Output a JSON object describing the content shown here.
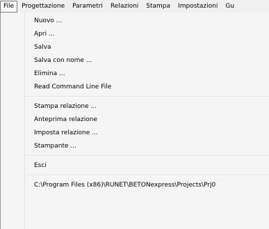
{
  "menubar": {
    "items": [
      {
        "label": "File",
        "active": true
      },
      {
        "label": "Progettazione"
      },
      {
        "label": "Parametri"
      },
      {
        "label": "Relazioni"
      },
      {
        "label": "Stampa"
      },
      {
        "label": "Impostazioni"
      },
      {
        "label": "Gu"
      }
    ]
  },
  "file_menu": {
    "group1": [
      {
        "label": "Nuovo ..."
      },
      {
        "label": "Apri ..."
      },
      {
        "label": "Salva"
      },
      {
        "label": "Salva con nome ..."
      },
      {
        "label": "Elimina ..."
      },
      {
        "label": "Read Command Line File"
      }
    ],
    "group2": [
      {
        "label": "Stampa relazione ..."
      },
      {
        "label": "Anteprima relazione"
      },
      {
        "label": "Imposta relazione ..."
      },
      {
        "label": "Stampante ..."
      }
    ],
    "group3": [
      {
        "label": "Esci"
      }
    ],
    "group4": [
      {
        "label": "C:\\Program Files (x86)\\RUNET\\BETONexpress\\Projects\\Prj0"
      }
    ]
  }
}
